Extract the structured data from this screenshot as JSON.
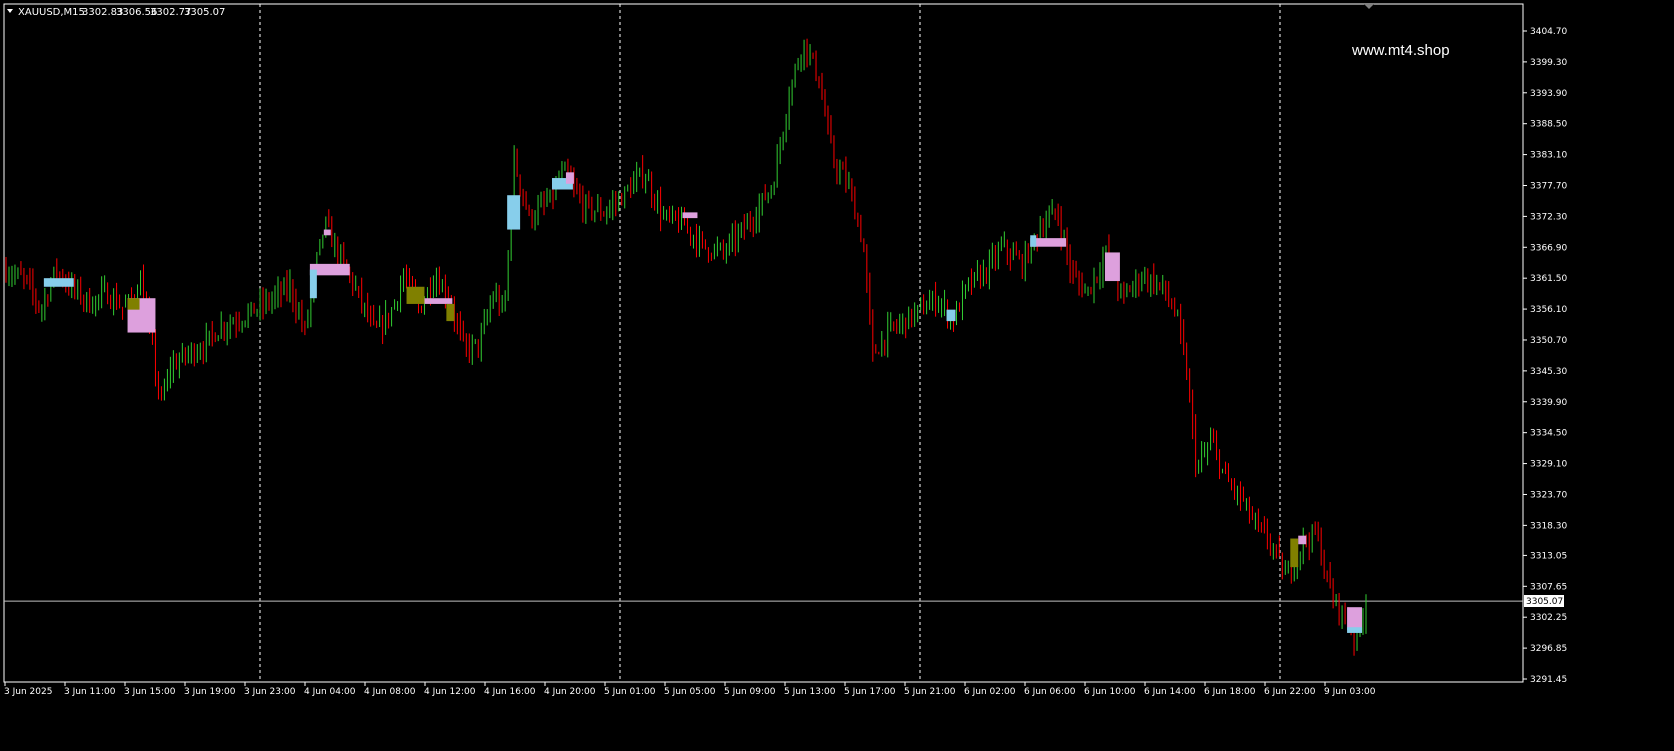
{
  "header": {
    "symbol": "XAUUSD,M15",
    "open": "3302.83",
    "high": "3306.56",
    "low": "3302.77",
    "close": "3305.07"
  },
  "watermark": "www.mt4.shop",
  "current_price_label": "3305.07",
  "colors": {
    "background": "#000000",
    "axis": "#ffffff",
    "bull": "#32cd32",
    "bear": "#ff0000",
    "separator": "#ffffff",
    "price_line": "#c0c0c0",
    "zone_blue": "#87ceeb",
    "zone_pink": "#dda0dd",
    "zone_olive": "#808000"
  },
  "chart_data": {
    "type": "candlestick",
    "title": "XAUUSD,M15",
    "xlabel": "",
    "ylabel": "",
    "ylim": [
      3291.45,
      3408
    ],
    "grid": false,
    "y_ticks": [
      "3404.70",
      "3399.30",
      "3393.90",
      "3388.50",
      "3383.10",
      "3377.70",
      "3372.30",
      "3366.90",
      "3361.50",
      "3356.10",
      "3350.70",
      "3345.30",
      "3339.90",
      "3334.50",
      "3329.10",
      "3323.70",
      "3318.30",
      "3313.05",
      "3307.65",
      "3302.25",
      "3296.85",
      "3291.45"
    ],
    "x_ticks": [
      "3 Jun 2025",
      "3 Jun 11:00",
      "3 Jun 15:00",
      "3 Jun 19:00",
      "3 Jun 23:00",
      "4 Jun 04:00",
      "4 Jun 08:00",
      "4 Jun 12:00",
      "4 Jun 16:00",
      "4 Jun 20:00",
      "5 Jun 01:00",
      "5 Jun 05:00",
      "5 Jun 09:00",
      "5 Jun 13:00",
      "5 Jun 17:00",
      "5 Jun 21:00",
      "6 Jun 02:00",
      "6 Jun 06:00",
      "6 Jun 10:00",
      "6 Jun 14:00",
      "6 Jun 18:00",
      "6 Jun 22:00",
      "9 Jun 03:00"
    ],
    "day_separators": [
      "3 Jun 23:00",
      "5 Jun 01:00",
      "5 Jun 21:00",
      "6 Jun 22:00"
    ],
    "current_price": 3305.07,
    "close_path": [
      {
        "t": 0,
        "p": 3363
      },
      {
        "t": 20,
        "p": 3361
      },
      {
        "t": 35,
        "p": 3356
      },
      {
        "t": 50,
        "p": 3363
      },
      {
        "t": 65,
        "p": 3360
      },
      {
        "t": 85,
        "p": 3357
      },
      {
        "t": 100,
        "p": 3359
      },
      {
        "t": 120,
        "p": 3356
      },
      {
        "t": 135,
        "p": 3361
      },
      {
        "t": 145,
        "p": 3352
      },
      {
        "t": 155,
        "p": 3339
      },
      {
        "t": 165,
        "p": 3346
      },
      {
        "t": 180,
        "p": 3348
      },
      {
        "t": 200,
        "p": 3350
      },
      {
        "t": 215,
        "p": 3353
      },
      {
        "t": 240,
        "p": 3355
      },
      {
        "t": 260,
        "p": 3357
      },
      {
        "t": 285,
        "p": 3360
      },
      {
        "t": 300,
        "p": 3352
      },
      {
        "t": 310,
        "p": 3363
      },
      {
        "t": 320,
        "p": 3371
      },
      {
        "t": 335,
        "p": 3365
      },
      {
        "t": 350,
        "p": 3360
      },
      {
        "t": 370,
        "p": 3352
      },
      {
        "t": 385,
        "p": 3355
      },
      {
        "t": 400,
        "p": 3362
      },
      {
        "t": 415,
        "p": 3356
      },
      {
        "t": 430,
        "p": 3362
      },
      {
        "t": 445,
        "p": 3358
      },
      {
        "t": 460,
        "p": 3349
      },
      {
        "t": 475,
        "p": 3350
      },
      {
        "t": 490,
        "p": 3359
      },
      {
        "t": 500,
        "p": 3355
      },
      {
        "t": 510,
        "p": 3382
      },
      {
        "t": 525,
        "p": 3372
      },
      {
        "t": 545,
        "p": 3375
      },
      {
        "t": 560,
        "p": 3380
      },
      {
        "t": 580,
        "p": 3374
      },
      {
        "t": 600,
        "p": 3373
      },
      {
        "t": 620,
        "p": 3376
      },
      {
        "t": 640,
        "p": 3380
      },
      {
        "t": 660,
        "p": 3372
      },
      {
        "t": 680,
        "p": 3371
      },
      {
        "t": 700,
        "p": 3367
      },
      {
        "t": 720,
        "p": 3366
      },
      {
        "t": 745,
        "p": 3371
      },
      {
        "t": 770,
        "p": 3378
      },
      {
        "t": 785,
        "p": 3393
      },
      {
        "t": 800,
        "p": 3403
      },
      {
        "t": 815,
        "p": 3397
      },
      {
        "t": 830,
        "p": 3382
      },
      {
        "t": 845,
        "p": 3378
      },
      {
        "t": 860,
        "p": 3368
      },
      {
        "t": 870,
        "p": 3348
      },
      {
        "t": 885,
        "p": 3352
      },
      {
        "t": 910,
        "p": 3355
      },
      {
        "t": 935,
        "p": 3358
      },
      {
        "t": 950,
        "p": 3354
      },
      {
        "t": 965,
        "p": 3360
      },
      {
        "t": 985,
        "p": 3363
      },
      {
        "t": 1000,
        "p": 3367
      },
      {
        "t": 1020,
        "p": 3364
      },
      {
        "t": 1040,
        "p": 3371
      },
      {
        "t": 1055,
        "p": 3373
      },
      {
        "t": 1070,
        "p": 3362
      },
      {
        "t": 1085,
        "p": 3359
      },
      {
        "t": 1105,
        "p": 3366
      },
      {
        "t": 1120,
        "p": 3358
      },
      {
        "t": 1140,
        "p": 3362
      },
      {
        "t": 1160,
        "p": 3360
      },
      {
        "t": 1175,
        "p": 3355
      },
      {
        "t": 1185,
        "p": 3345
      },
      {
        "t": 1195,
        "p": 3328
      },
      {
        "t": 1210,
        "p": 3333
      },
      {
        "t": 1225,
        "p": 3326
      },
      {
        "t": 1240,
        "p": 3323
      },
      {
        "t": 1255,
        "p": 3318
      },
      {
        "t": 1270,
        "p": 3315
      },
      {
        "t": 1285,
        "p": 3309
      },
      {
        "t": 1300,
        "p": 3315
      },
      {
        "t": 1315,
        "p": 3317
      },
      {
        "t": 1330,
        "p": 3306
      },
      {
        "t": 1345,
        "p": 3302
      },
      {
        "t": 1355,
        "p": 3298
      },
      {
        "t": 1365,
        "p": 3305.07
      }
    ],
    "zones": [
      {
        "color": "zone_blue",
        "t0": 38,
        "t1": 68,
        "p0": 3360,
        "p1": 3361.5
      },
      {
        "color": "zone_pink",
        "t0": 122,
        "t1": 150,
        "p0": 3352,
        "p1": 3358
      },
      {
        "color": "zone_olive",
        "t0": 122,
        "t1": 134,
        "p0": 3356,
        "p1": 3358
      },
      {
        "color": "zone_pink",
        "t0": 305,
        "t1": 345,
        "p0": 3362,
        "p1": 3364
      },
      {
        "color": "zone_blue",
        "t0": 305,
        "t1": 312,
        "p0": 3358,
        "p1": 3363
      },
      {
        "color": "zone_pink",
        "t0": 319,
        "t1": 326,
        "p0": 3369,
        "p1": 3370
      },
      {
        "color": "zone_olive",
        "t0": 402,
        "t1": 420,
        "p0": 3357,
        "p1": 3360
      },
      {
        "color": "zone_pink",
        "t0": 420,
        "t1": 448,
        "p0": 3357,
        "p1": 3358
      },
      {
        "color": "zone_olive",
        "t0": 442,
        "t1": 450,
        "p0": 3354,
        "p1": 3357
      },
      {
        "color": "zone_blue",
        "t0": 503,
        "t1": 516,
        "p0": 3370,
        "p1": 3376
      },
      {
        "color": "zone_blue",
        "t0": 548,
        "t1": 569,
        "p0": 3377,
        "p1": 3379
      },
      {
        "color": "zone_pink",
        "t0": 562,
        "t1": 570,
        "p0": 3378,
        "p1": 3380
      },
      {
        "color": "zone_pink",
        "t0": 679,
        "t1": 694,
        "p0": 3372,
        "p1": 3373
      },
      {
        "color": "zone_blue",
        "t0": 944,
        "t1": 953,
        "p0": 3354,
        "p1": 3356
      },
      {
        "color": "zone_pink",
        "t0": 1028,
        "t1": 1064,
        "p0": 3367,
        "p1": 3368.5
      },
      {
        "color": "zone_blue",
        "t0": 1028,
        "t1": 1034,
        "p0": 3367,
        "p1": 3369
      },
      {
        "color": "zone_pink",
        "t0": 1103,
        "t1": 1118,
        "p0": 3361,
        "p1": 3366
      },
      {
        "color": "zone_olive",
        "t0": 1289,
        "t1": 1297,
        "p0": 3311,
        "p1": 3316
      },
      {
        "color": "zone_pink",
        "t0": 1297,
        "t1": 1305,
        "p0": 3315,
        "p1": 3316.5
      },
      {
        "color": "zone_pink",
        "t0": 1346,
        "t1": 1361,
        "p0": 3300,
        "p1": 3304
      },
      {
        "color": "zone_blue",
        "t0": 1346,
        "t1": 1361,
        "p0": 3299.5,
        "p1": 3300.5
      }
    ]
  }
}
